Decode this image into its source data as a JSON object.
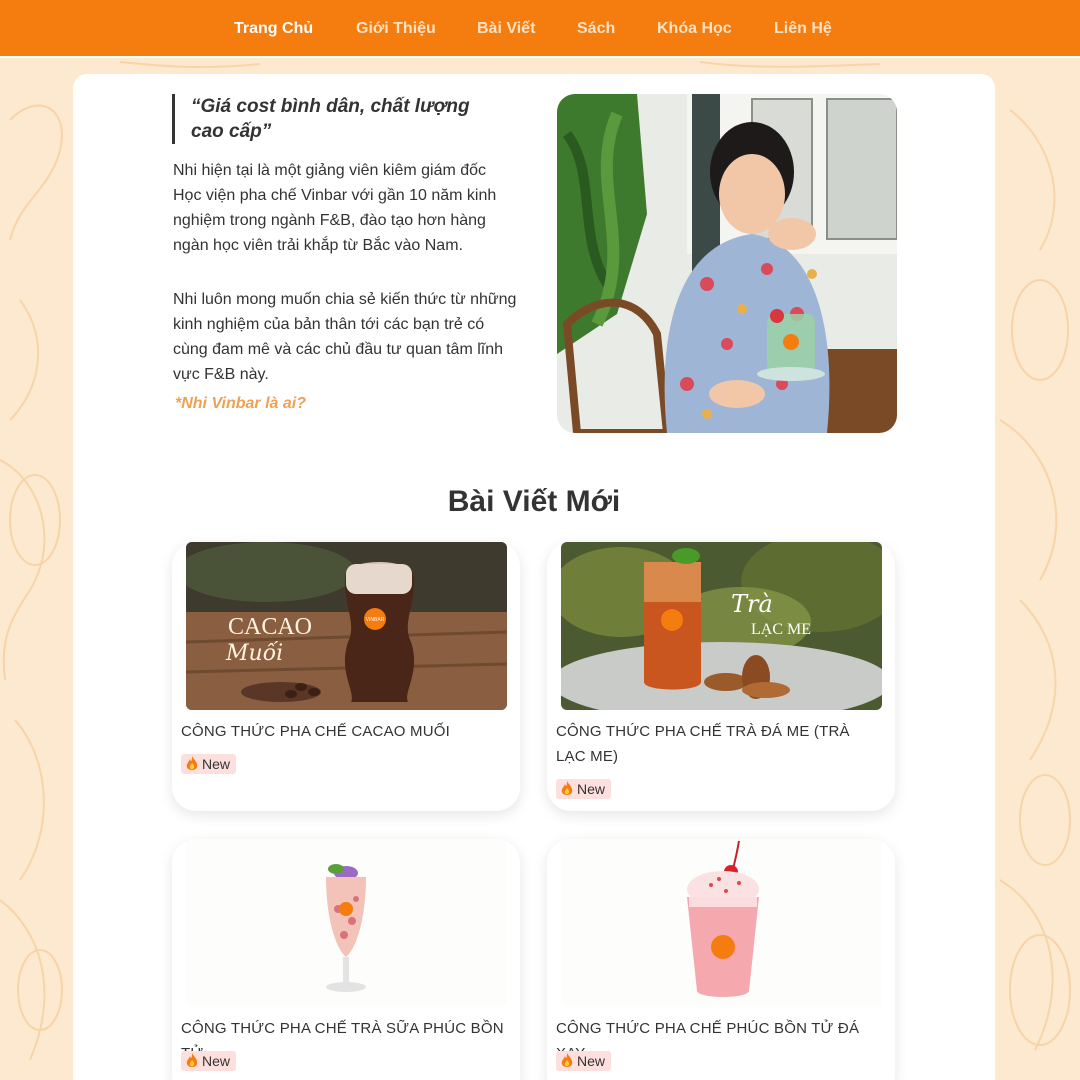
{
  "nav": {
    "items": [
      {
        "label": "Trang Chủ",
        "active": true
      },
      {
        "label": "Giới Thiệu",
        "active": false
      },
      {
        "label": "Bài Viết",
        "active": false
      },
      {
        "label": "Sách",
        "active": false
      },
      {
        "label": "Khóa Học",
        "active": false
      },
      {
        "label": "Liên Hệ",
        "active": false
      }
    ]
  },
  "intro": {
    "quote": "“Giá cost bình dân, chất lượng cao cấp”",
    "paragraph1": "Nhi hiện tại là một giảng viên kiêm giám đốc Học viện pha chế Vinbar với gần 10 năm kinh nghiệm trong ngành F&B, đào tạo hơn hàng ngàn học viên trải khắp từ Bắc vào Nam.",
    "paragraph2": "Nhi luôn mong muốn chia sẻ kiến thức từ những kinh nghiệm của bản thân tới các bạn trẻ có cùng đam mê và các chủ đầu tư quan tâm lĩnh vực F&B này.",
    "link": "*Nhi Vinbar là ai?"
  },
  "posts_section": {
    "title": "Bài Viết Mới",
    "posts": [
      {
        "title": "CÔNG THỨC PHA CHẾ CACAO MUỐI",
        "badge": "New",
        "image_text": [
          "CACAO",
          "Muối"
        ]
      },
      {
        "title": "CÔNG THỨC PHA CHẾ TRÀ ĐÁ ME (TRÀ LẠC ME)",
        "badge": "New",
        "image_text": [
          "Trà",
          "LẠC ME"
        ]
      },
      {
        "title": "CÔNG THỨC PHA CHẾ TRÀ SỮA PHÚC BỒN TỬ",
        "badge": "New"
      },
      {
        "title": "CÔNG THỨC PHA CHẾ PHÚC BỒN TỬ ĐÁ XAY",
        "badge": "New"
      }
    ],
    "cup_logo": "VINBAR"
  },
  "colors": {
    "nav_bg": "#f57c0f",
    "page_bg": "#fde9cf",
    "link": "#f0a050",
    "badge_bg": "#fde0dd"
  }
}
